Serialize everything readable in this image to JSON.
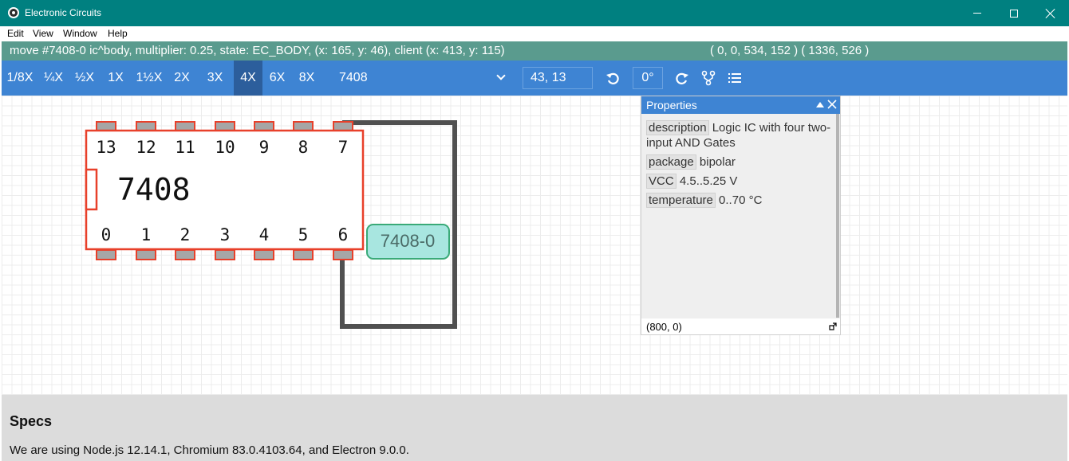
{
  "window": {
    "title": "Electronic Circuits"
  },
  "menu": [
    "Edit",
    "View",
    "Window",
    "Help"
  ],
  "status": {
    "left": "move #7408-0 ic^body, multiplier: 0.25, state: EC_BODY, (x: 165, y: 46), client (x: 413, y: 115)",
    "right": "( 0, 0, 534, 152 )  ( 1336, 526 )"
  },
  "toolbar": {
    "zoom_levels": [
      "1/8X",
      "¼X",
      "½X",
      "1X",
      "1½X",
      "2X",
      "3X",
      "4X",
      "6X",
      "8X"
    ],
    "active_zoom": "4X",
    "component_select": "7408",
    "coordinates": "43, 13",
    "rotation": "0°",
    "icons": [
      "rotate-left-icon",
      "rotate-right-icon",
      "circuit-icon",
      "list-icon"
    ]
  },
  "circuit": {
    "chip_label": "7408",
    "pins_top": [
      "13",
      "12",
      "11",
      "10",
      "9",
      "8",
      "7"
    ],
    "pins_bottom": [
      "0",
      "1",
      "2",
      "3",
      "4",
      "5",
      "6"
    ],
    "tag": "7408-0",
    "colors": {
      "outline": "#e8402a",
      "pin": "#a6a6a6",
      "wire": "#505050",
      "tag_bg": "#a8e6e0",
      "tag_border": "#3aaa78"
    }
  },
  "properties": {
    "title": "Properties",
    "rows": [
      {
        "key": "description",
        "value": "Logic IC with four two-input AND Gates"
      },
      {
        "key": "package",
        "value": "bipolar"
      },
      {
        "key": "VCC",
        "value": "4.5..5.25 V"
      },
      {
        "key": "temperature",
        "value": "0..70 °C"
      }
    ],
    "footer": "(800, 0)"
  },
  "specs": {
    "title": "Specs",
    "text": "We are using Node.js 12.14.1, Chromium 83.0.4103.64, and Electron 9.0.0."
  }
}
